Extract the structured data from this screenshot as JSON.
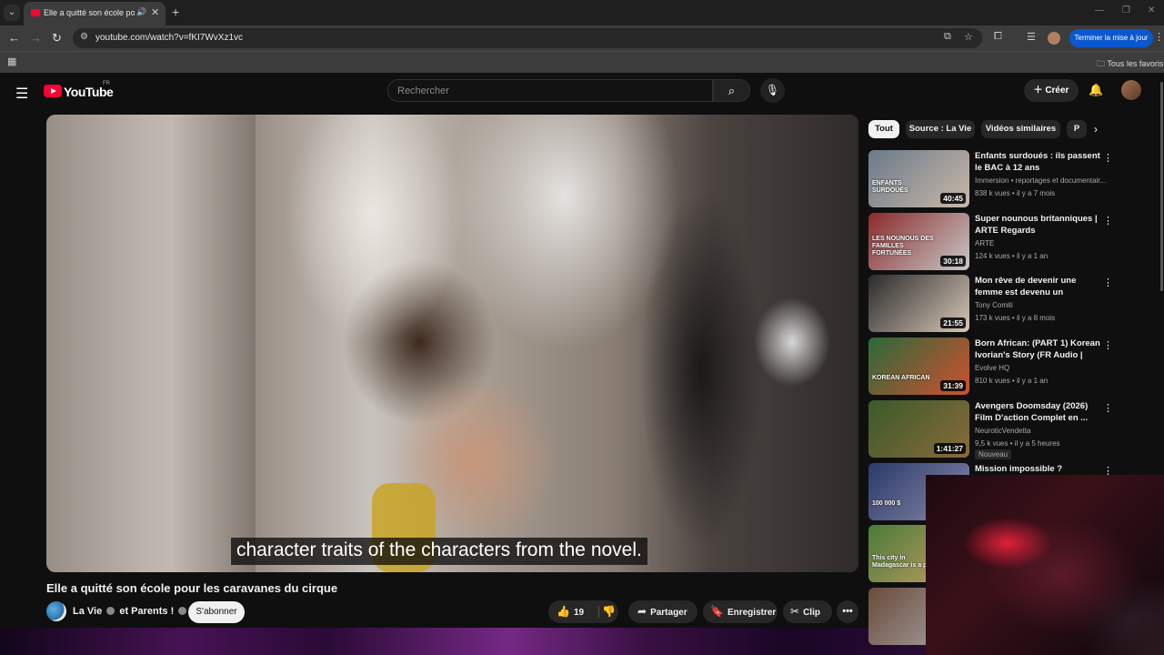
{
  "browser": {
    "tab_title": "Elle a quitté son école pour les caravanes du cirque",
    "url": "youtube.com/watch?v=fKI7WvXz1vc",
    "update_button": "Terminer la mise à jour",
    "bookmarks_folder": "Tous les favoris"
  },
  "header": {
    "logo_text": "YouTube",
    "country_code": "FR",
    "search_placeholder": "Rechercher",
    "create_label": "Créer"
  },
  "video": {
    "subtitle": "character traits of the characters from the novel.",
    "title": "Elle a quitté son école pour les caravanes du cirque",
    "channel_primary": "La Vie",
    "channel_joiner": "et Parents !",
    "subscribe_label": "S'abonner",
    "likes": "19",
    "share_label": "Partager",
    "save_label": "Enregistrer",
    "clip_label": "Clip"
  },
  "chips": [
    "Tout",
    "Source : La Vie",
    "Vidéos similaires",
    "P"
  ],
  "recommendations": [
    {
      "title": "Enfants surdoués : ils passent le BAC à 12 ans",
      "channel": "Immersion • reportages et documentair...",
      "meta": "838 k vues • il y a 7 mois",
      "duration": "40:45",
      "thumb_text": "ENFANTS SURDOUÉS",
      "colors": [
        "#6a7a8a",
        "#c9b8a8"
      ]
    },
    {
      "title": "Super nounous britanniques | ARTE Regards",
      "channel": "ARTE",
      "meta": "124 k vues • il y a 1 an",
      "duration": "30:18",
      "thumb_text": "LES NOUNOUS DES FAMILLES FORTUNÉES",
      "colors": [
        "#8a2a2a",
        "#c8c8c8"
      ]
    },
    {
      "title": "Mon rêve de devenir une femme est devenu un cauchemar",
      "channel": "Tony Comiti",
      "meta": "173 k vues • il y a 8 mois",
      "duration": "21:55",
      "thumb_text": "",
      "colors": [
        "#2a2a2a",
        "#d8c8b8"
      ]
    },
    {
      "title": "Born African: (PART 1) Korean Ivorian's Story (FR Audio | ENG...",
      "channel": "Evolve HQ",
      "meta": "810 k vues • il y a 1 an",
      "duration": "31:39",
      "thumb_text": "KOREAN AFRICAN",
      "colors": [
        "#2a6a3a",
        "#d05030"
      ]
    },
    {
      "title": "Avengers Doomsday (2026) Film D'action Complet en ...",
      "channel": "NeuroticVendetta",
      "meta": "9,5 k vues • il y a 5 heures",
      "duration": "1:41:27",
      "badge": "Nouveau",
      "thumb_text": "",
      "colors": [
        "#3a5a2a",
        "#8a6a3a"
      ]
    },
    {
      "title": "Mission impossible ? Restaurer",
      "channel": "",
      "meta": "",
      "duration": "",
      "thumb_text": "100 000 $",
      "colors": [
        "#2a3a6a",
        "#8a8aa8"
      ]
    },
    {
      "title": "",
      "channel": "",
      "meta": "",
      "duration": "",
      "thumb_text": "This city in Madagascar is a par",
      "colors": [
        "#4a7a3a",
        "#c8a060"
      ]
    },
    {
      "title": "",
      "channel": "",
      "meta": "",
      "duration": "",
      "thumb_text": "",
      "colors": [
        "#6a4a3a",
        "#a8a8a8"
      ]
    }
  ]
}
